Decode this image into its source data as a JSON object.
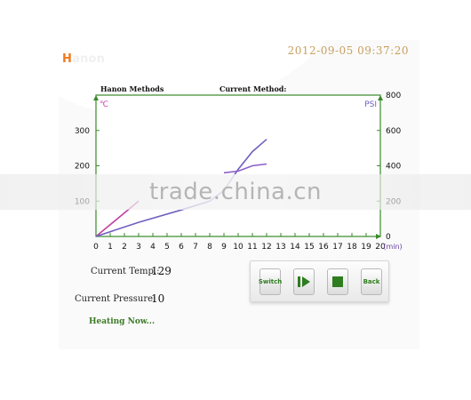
{
  "header": {
    "logo_text": "anon",
    "logo_initial": "H",
    "datetime": "2012-09-05 09:37:20"
  },
  "chart_header": {
    "methods_label": "Hanon Methods",
    "current_method_label": "Current Method:"
  },
  "chart_data": {
    "type": "line",
    "left_axis": {
      "unit": "℃",
      "ticks": [
        100,
        200,
        300
      ]
    },
    "right_axis": {
      "unit": "PSI",
      "ticks": [
        0,
        200,
        400,
        600,
        800
      ]
    },
    "x_axis": {
      "unit": "(min)",
      "ticks": [
        0,
        1,
        2,
        3,
        4,
        5,
        6,
        7,
        8,
        9,
        10,
        11,
        12,
        13,
        14,
        15,
        16,
        17,
        18,
        19,
        20
      ]
    },
    "series": [
      {
        "color": "#c040a0",
        "points": [
          [
            0,
            0
          ],
          [
            3,
            100
          ]
        ]
      },
      {
        "color": "#7060c0",
        "points": [
          [
            0,
            0
          ],
          [
            3,
            40
          ],
          [
            6,
            75
          ],
          [
            8,
            100
          ],
          [
            9,
            130
          ],
          [
            10,
            190
          ],
          [
            11,
            240
          ],
          [
            12,
            275
          ]
        ]
      },
      {
        "color": "#8a60c8",
        "points": [
          [
            9,
            180
          ],
          [
            10,
            185
          ],
          [
            11,
            200
          ],
          [
            12,
            205
          ]
        ]
      }
    ]
  },
  "readouts": {
    "temp_label": "Current Temp.:",
    "temp_value": "129",
    "pressure_label": "Current Pressure:",
    "pressure_value": "10",
    "status": "Heating Now..."
  },
  "buttons": {
    "switch_label": "Switch",
    "back_label": "Back"
  },
  "watermark": "trade.china.cn",
  "colors": {
    "frame": "#000000",
    "grid_axis": "#3a8a2a",
    "clock": "#c8a060",
    "status": "#3b7a26",
    "button_text": "#2e7d1f",
    "logo_accent": "#f07a1e"
  }
}
